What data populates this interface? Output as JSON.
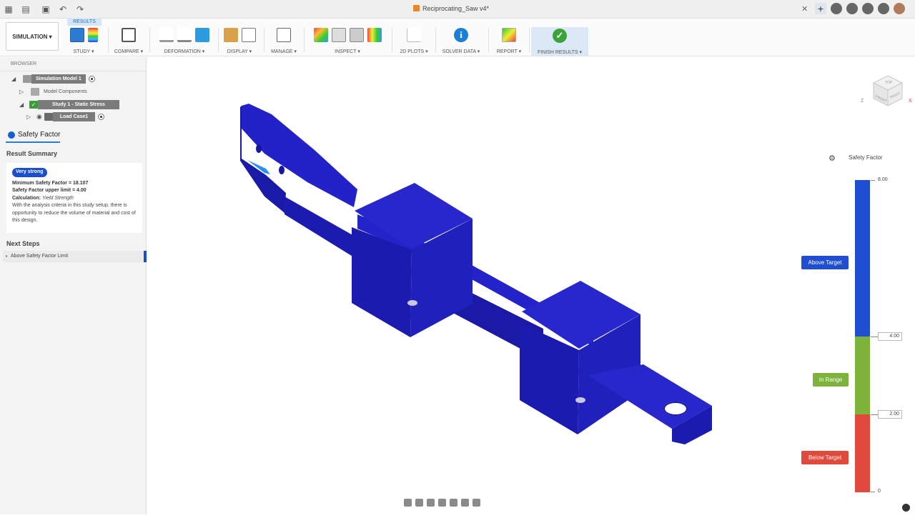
{
  "window": {
    "doc_title": "Reciprocating_Saw v4*"
  },
  "toolbar": {
    "workspace": "SIMULATION ▾",
    "results_tab": "RESULTS",
    "groups": [
      {
        "label": "STUDY ▾"
      },
      {
        "label": "COMPARE ▾"
      },
      {
        "label": "DEFORMATION ▾"
      },
      {
        "label": "DISPLAY ▾"
      },
      {
        "label": "MANAGE ▾"
      },
      {
        "label": "INSPECT ▾"
      },
      {
        "label": "2D PLOTS ▾"
      },
      {
        "label": "SOLVER DATA ▾"
      },
      {
        "label": "REPORT ▾"
      },
      {
        "label": "FINISH RESULTS ▾"
      }
    ]
  },
  "browser": {
    "header": "BROWSER",
    "items": [
      {
        "label": "Simulation Model 1"
      },
      {
        "label": "Model Components"
      },
      {
        "label": "Study 1 - Static Stress"
      },
      {
        "label": "Load Case1"
      }
    ]
  },
  "result_panel": {
    "title": "Safety Factor",
    "summary_title": "Result Summary",
    "badge": "Very strong",
    "min_sf": "Minimum Safety Factor = 18.107",
    "upper_limit": "Safety Factor upper limit = 4.00",
    "calc_label": "Calculation: ",
    "calc_value": "Yield Strength",
    "desc": "With the analysis criteria in this study setup, there is opportunity to reduce the volume of material and cost of this design.",
    "next_steps_title": "Next Steps",
    "next_step_item": "Above Safety Factor Limit"
  },
  "legend": {
    "title": "Safety Factor",
    "max": "8.00",
    "upper": "4.00",
    "lower": "2.00",
    "min": "0",
    "above": "Above Target",
    "in_range": "In Range",
    "below": "Below Target",
    "colors": {
      "above": "#1f4fd0",
      "in_range": "#7db33a",
      "below": "#e04a3c"
    }
  },
  "viewcube": {
    "top": "TOP",
    "front": "FRONT",
    "right": "RIGHT",
    "axis_x": "X",
    "axis_z": "Z"
  },
  "model": {
    "color": "#1f1fbf"
  }
}
